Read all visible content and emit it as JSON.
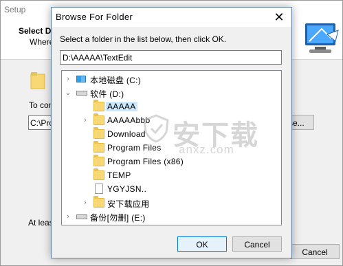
{
  "setup": {
    "title": "Setup",
    "heading": "Select D",
    "subheading": "Where",
    "to_continue": "To con",
    "path_value": "C:\\Pro",
    "browse_label": "se...",
    "at_least": "At least",
    "cancel_label": "Cancel"
  },
  "dialog": {
    "title": "Browse For Folder",
    "close_glyph": "✕",
    "instruction": "Select a folder in the list below, then click OK.",
    "path_value": "D:\\AAAAA\\TextEdit",
    "ok_label": "OK",
    "cancel_label": "Cancel",
    "tree": [
      {
        "label": "本地磁盘 (C:)",
        "toggle": "›"
      },
      {
        "label": "软件 (D:)",
        "toggle": "⌄"
      },
      {
        "label": "AAAAA",
        "toggle": ""
      },
      {
        "label": "AAAAAbbb",
        "toggle": "›"
      },
      {
        "label": "Download",
        "toggle": ""
      },
      {
        "label": "Program Files",
        "toggle": ""
      },
      {
        "label": "Program Files (x86)",
        "toggle": ""
      },
      {
        "label": "TEMP",
        "toggle": ""
      },
      {
        "label": "YGYJSN..",
        "toggle": ""
      },
      {
        "label": "安下载应用",
        "toggle": "›"
      },
      {
        "label": "备份[勿删] (E:)",
        "toggle": "›"
      }
    ]
  },
  "watermark": {
    "text": "安下载",
    "sub": "anxz.com"
  }
}
